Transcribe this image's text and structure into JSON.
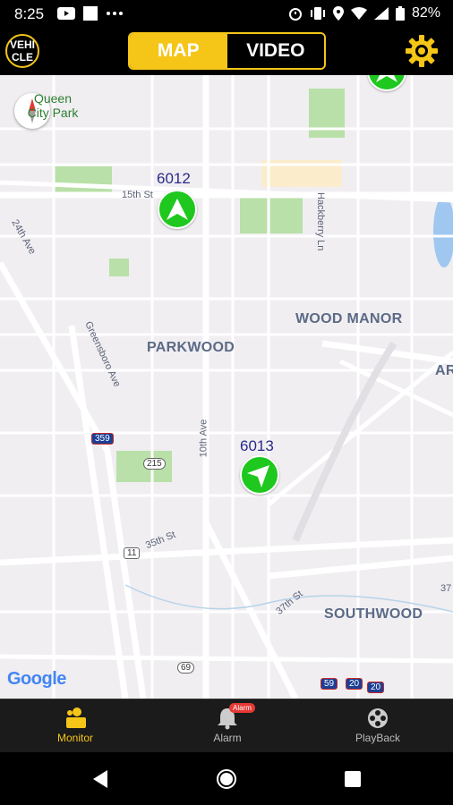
{
  "status_bar": {
    "time": "8:25",
    "battery": "82%"
  },
  "app_bar": {
    "vehicle_button_label": "VEHICLE",
    "tabs": [
      {
        "label": "MAP",
        "active": true
      },
      {
        "label": "VIDEO",
        "active": false
      }
    ],
    "accent_color": "#f5c518"
  },
  "map": {
    "park_label": "Queen City Park",
    "streets": [
      "15th St",
      "24th Ave",
      "Greensboro Ave",
      "10th Ave",
      "Hackberry Ln",
      "35th St",
      "37th St"
    ],
    "places": [
      "WOOD MANOR",
      "PARKWOOD",
      "SOUTHWOOD"
    ],
    "partial_place": "AR",
    "route_shields": [
      "359",
      "215",
      "11",
      "69",
      "59",
      "20",
      "20"
    ],
    "edge_number": "37",
    "vehicles": [
      {
        "id": "6012",
        "heading": "north"
      },
      {
        "id": "6013",
        "heading": "northeast"
      }
    ],
    "attribution": "Google"
  },
  "bottom_nav": {
    "items": [
      {
        "label": "Monitor",
        "active": true
      },
      {
        "label": "Alarm",
        "active": false,
        "badge": "Alarm"
      },
      {
        "label": "PlayBack",
        "active": false
      }
    ]
  }
}
